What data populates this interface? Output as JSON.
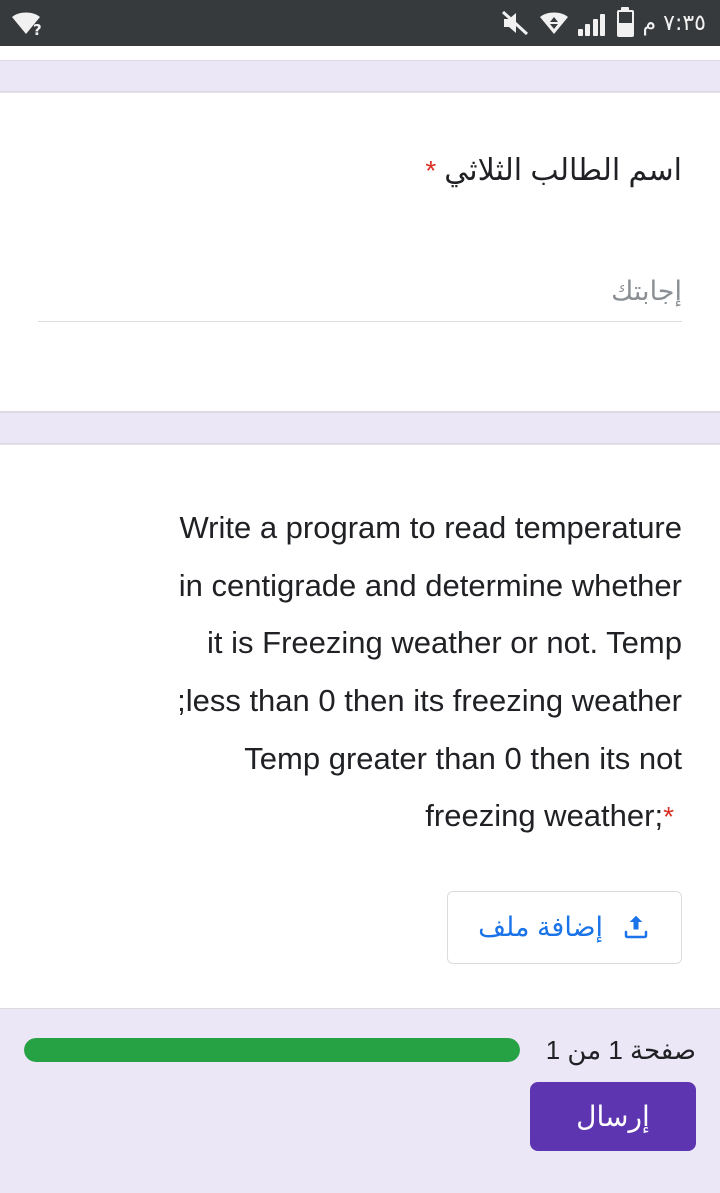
{
  "status_bar": {
    "time": "٧:٣٥ م",
    "icons": {
      "wifi_no_internet": "wifi-question-icon",
      "mute": "volume-mute-icon",
      "wifi": "wifi-icon",
      "signal": "cellular-signal-icon",
      "battery": "battery-icon"
    },
    "background_color": "#373a3c",
    "foreground_color": "#f1f1f1"
  },
  "form": {
    "question_1": {
      "title": "اسم الطالب الثلاثي",
      "required_marker": "*",
      "answer_placeholder": "إجابتك",
      "answer_value": ""
    },
    "question_2": {
      "text_lines": [
        "Write a program to read temperature",
        "in centigrade and determine whether",
        "it is Freezing weather or not. Temp",
        "less than 0 then its freezing weather;",
        "Temp greater than 0 then its not",
        ";freezing weather"
      ],
      "full_text": "Write a program to read temperature in centigrade and determine whether it is Freezing weather or not. Temp less than 0 then its freezing weather; Temp greater than 0 then its not freezing weather;",
      "required_marker": "*",
      "upload_button_label": "إضافة ملف",
      "upload_icon": "upload-icon"
    }
  },
  "footer": {
    "page_label": "صفحة 1 من 1",
    "progress_percent": 100,
    "progress_color": "#26a244",
    "submit_label": "إرسال",
    "submit_color": "#5e35b1",
    "background_color": "#ece7f6"
  },
  "theme": {
    "required_star_color": "#d93025",
    "link_blue": "#1a73e8",
    "card_background": "#ffffff",
    "page_background": "#ece7f6"
  }
}
